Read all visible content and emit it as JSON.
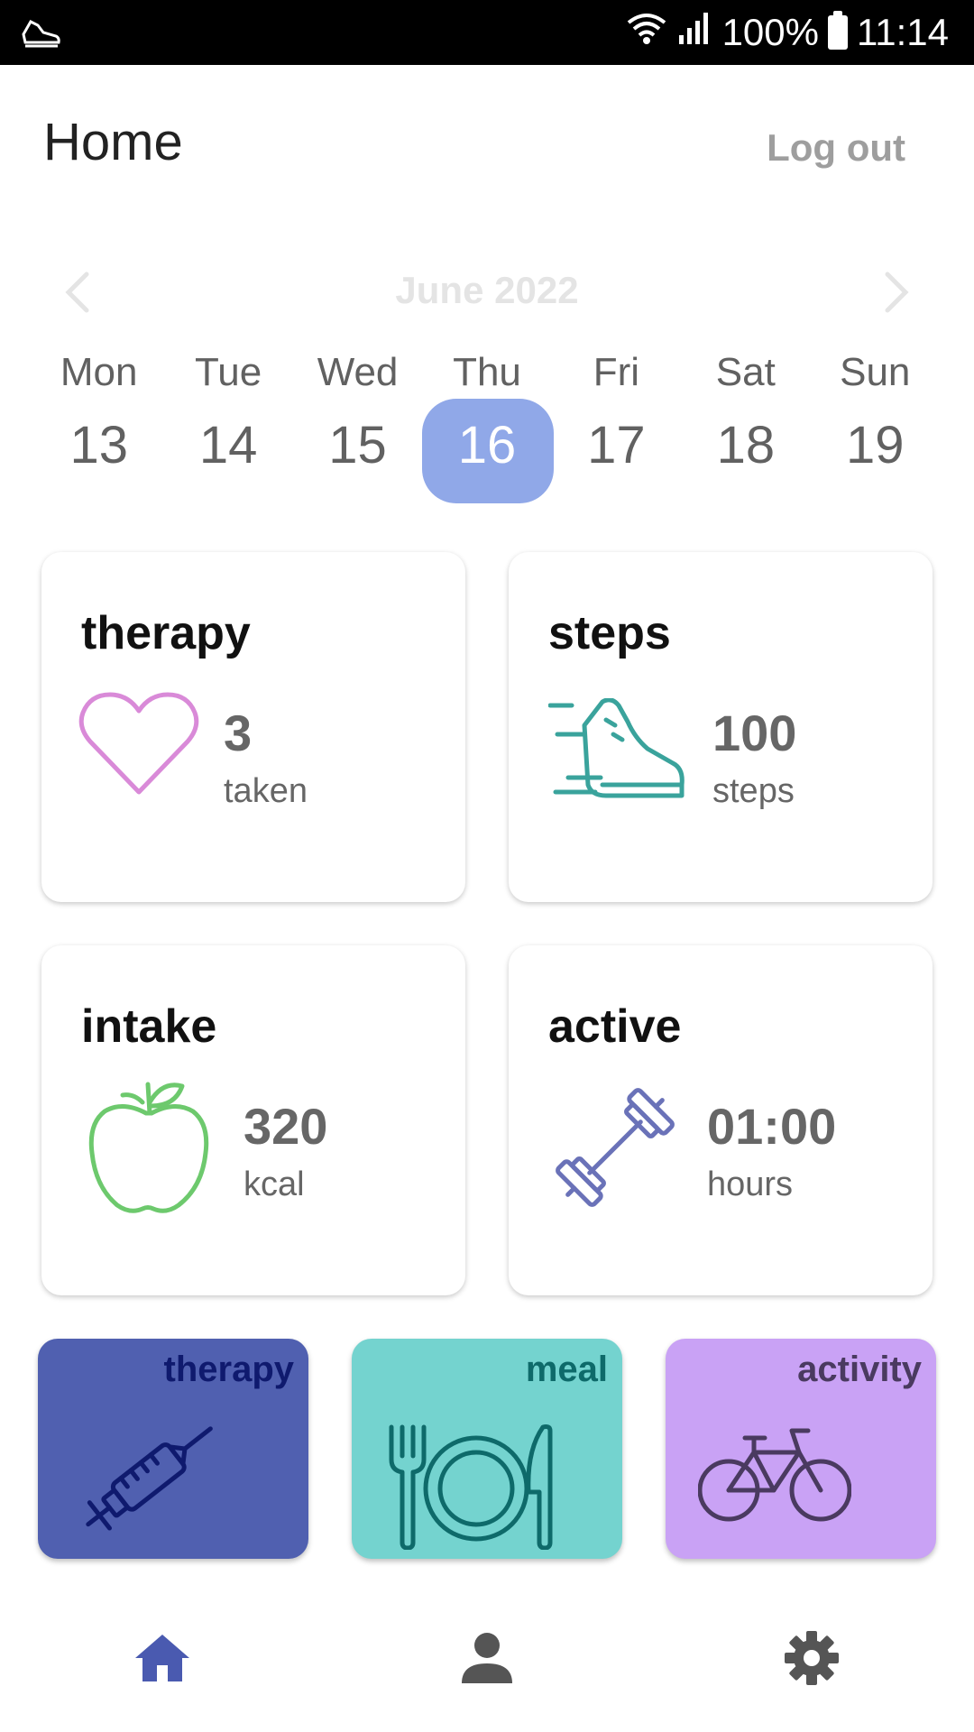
{
  "status_bar": {
    "battery": "100%",
    "time": "11:14",
    "icons": [
      "shoe-notification-icon",
      "wifi-icon",
      "signal-icon",
      "battery-icon"
    ]
  },
  "header": {
    "title": "Home",
    "logout_label": "Log out"
  },
  "calendar": {
    "month": "June 2022",
    "days": [
      {
        "name": "Mon",
        "num": "13"
      },
      {
        "name": "Tue",
        "num": "14"
      },
      {
        "name": "Wed",
        "num": "15"
      },
      {
        "name": "Thu",
        "num": "16",
        "selected": true
      },
      {
        "name": "Fri",
        "num": "17"
      },
      {
        "name": "Sat",
        "num": "18"
      },
      {
        "name": "Sun",
        "num": "19"
      }
    ],
    "selected_color": "#90a8e8"
  },
  "cards": {
    "therapy": {
      "title": "therapy",
      "value": "3",
      "unit": "taken",
      "icon": "heart-icon",
      "color": "#d98ad8"
    },
    "steps": {
      "title": "steps",
      "value": "100",
      "unit": "steps",
      "icon": "running-shoe-icon",
      "color": "#3aa39c"
    },
    "intake": {
      "title": "intake",
      "value": "320",
      "unit": "kcal",
      "icon": "apple-icon",
      "color": "#6dc96d"
    },
    "active": {
      "title": "active",
      "value": "01:00",
      "unit": "hours",
      "icon": "dumbbell-icon",
      "color": "#6a72b8"
    }
  },
  "tiles": {
    "therapy": {
      "label": "therapy",
      "icon": "syringe-icon",
      "bg": "#5060b0",
      "fg": "#0f1a6e"
    },
    "meal": {
      "label": "meal",
      "icon": "plate-cutlery-icon",
      "bg": "#74d3cf",
      "fg": "#0e6a6a"
    },
    "activity": {
      "label": "activity",
      "icon": "bicycle-icon",
      "bg": "#c9a2f5",
      "fg": "#4a3a60"
    }
  },
  "nav": {
    "items": [
      {
        "icon": "home-icon",
        "active": true
      },
      {
        "icon": "profile-icon",
        "active": false
      },
      {
        "icon": "settings-icon",
        "active": false
      }
    ],
    "active_color": "#4a5ab0",
    "inactive_color": "#555555"
  }
}
